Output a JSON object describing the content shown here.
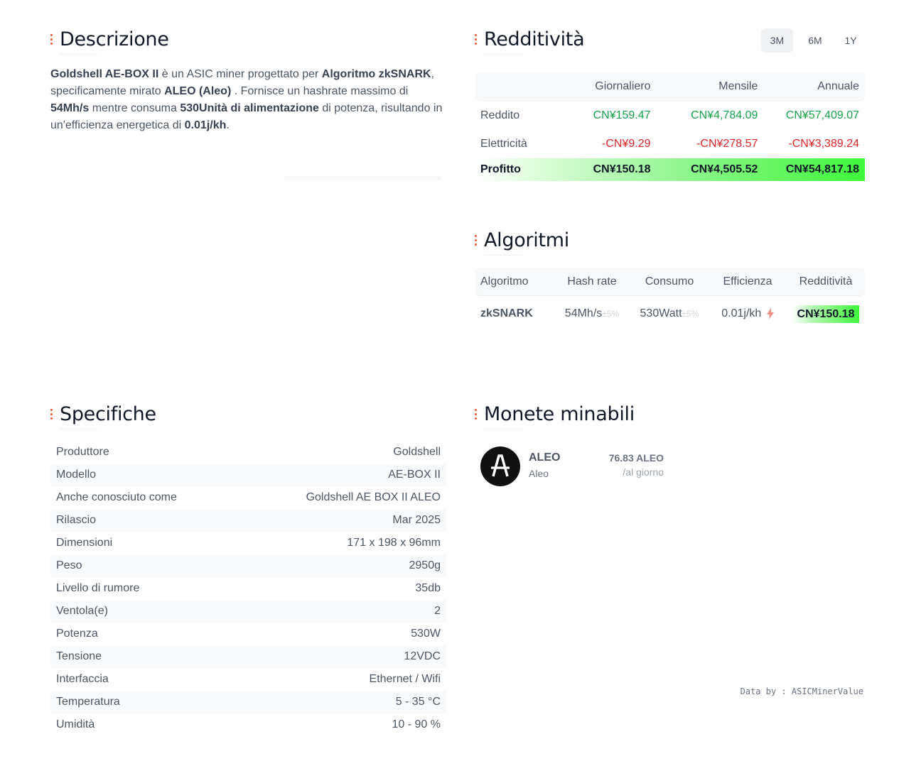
{
  "sections": {
    "description_title": "Descrizione",
    "profitability_title": "Redditività",
    "algorithms_title": "Algoritmi",
    "specs_title": "Specifiche",
    "coins_title": "Monete minabili"
  },
  "description": {
    "p1_bold": "Goldshell AE-BOX II",
    "p2": " è un ASIC miner progettato per ",
    "p3_bold": "Algoritmo zkSNARK",
    "p4": ", specificamente mirato ",
    "p5_bold": "ALEO (Aleo)",
    "p6": " . Fornisce un hashrate massimo di ",
    "p7_bold": "54Mh/s",
    "p8": " mentre consuma ",
    "p9_bold": "530Unità di alimentazione",
    "p10": " di potenza, risultando in un'efficienza energetica di ",
    "p11_bold": "0.01j/kh",
    "p12": "."
  },
  "periods": [
    "3M",
    "6M",
    "1Y"
  ],
  "profitability": {
    "headers": [
      "Giornaliero",
      "Mensile",
      "Annuale"
    ],
    "rows": [
      {
        "label": "Reddito",
        "values": [
          "CN¥159.47",
          "CN¥4,784.09",
          "CN¥57,409.07"
        ]
      },
      {
        "label": "Elettricità",
        "values": [
          "-CN¥9.29",
          "-CN¥278.57",
          "-CN¥3,389.24"
        ]
      },
      {
        "label": "Profitto",
        "values": [
          "CN¥150.18",
          "CN¥4,505.52",
          "CN¥54,817.18"
        ]
      }
    ]
  },
  "algorithms": {
    "headers": [
      "Algoritmo",
      "Hash rate",
      "Consumo",
      "Efficienza",
      "Redditività"
    ],
    "row": {
      "name": "zkSNARK",
      "hashrate": "54Mh/s",
      "hashrate_tol": "±5%",
      "power": "530Watt",
      "power_tol": "±5%",
      "efficiency": "0.01j/kh",
      "profit": "CN¥150.18"
    }
  },
  "specs": [
    {
      "label": "Produttore",
      "value": "Goldshell"
    },
    {
      "label": "Modello",
      "value": "AE-BOX II"
    },
    {
      "label": "Anche conosciuto come",
      "value": "Goldshell AE BOX II ALEO"
    },
    {
      "label": "Rilascio",
      "value": "Mar 2025"
    },
    {
      "label": "Dimensioni",
      "value": "171 x 198 x 96mm"
    },
    {
      "label": "Peso",
      "value": "2950g"
    },
    {
      "label": "Livello di rumore",
      "value": "35db"
    },
    {
      "label": "Ventola(e)",
      "value": "2"
    },
    {
      "label": "Potenza",
      "value": "530W"
    },
    {
      "label": "Tensione",
      "value": "12VDC"
    },
    {
      "label": "Interfaccia",
      "value": "Ethernet / Wifi"
    },
    {
      "label": "Temperatura",
      "value": "5 - 35 °C"
    },
    {
      "label": "Umidità",
      "value": "10 - 90 %"
    }
  ],
  "coin": {
    "symbol": "ALEO",
    "name": "Aleo",
    "amount": "76.83 ALEO",
    "unit": "/al giorno",
    "icon": "aleo-logo-icon"
  },
  "footer": {
    "data_by": "Data by : ASICMinerValue"
  },
  "colors": {
    "accent": "#e8663d",
    "positive": "#16a34a",
    "negative": "#dc2626",
    "profit_bg": "#3ef73a"
  }
}
